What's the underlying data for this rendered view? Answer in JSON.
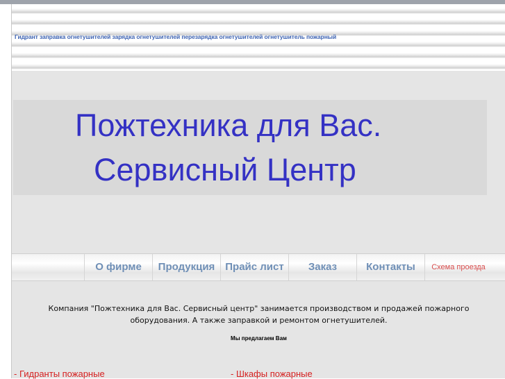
{
  "keywords": "Гидрант заправка огнетушителей зарядка огнетушителей перезарядка огнетушителей огнетушитель пожарный",
  "hero": {
    "line1": "Пожтехника для Вас.",
    "line2": "Сервисный Центр"
  },
  "nav": {
    "items": [
      {
        "label": "О фирме"
      },
      {
        "label": "Продукция"
      },
      {
        "label": "Прайс лист"
      },
      {
        "label": "Заказ"
      },
      {
        "label": "Контакты"
      },
      {
        "label": "Схема проезда"
      }
    ]
  },
  "intro": {
    "line1": "Компания \"Пожтехника для Вас. Сервисный центр\" занимается производством и продажей пожарного",
    "line2": "оборудования. А также заправкой и ремонтом огнетушителей."
  },
  "offer_heading": "Мы предлагаем Вам",
  "products": [
    {
      "label": "- Гидранты пожарные"
    },
    {
      "label": "- Шкафы пожарные"
    }
  ],
  "colors": {
    "hero_text": "#3431c4",
    "nav_text": "#6f8fb6",
    "map_link": "#d84c4c",
    "product_link": "#d62020",
    "keywords": "#3d63b3"
  }
}
